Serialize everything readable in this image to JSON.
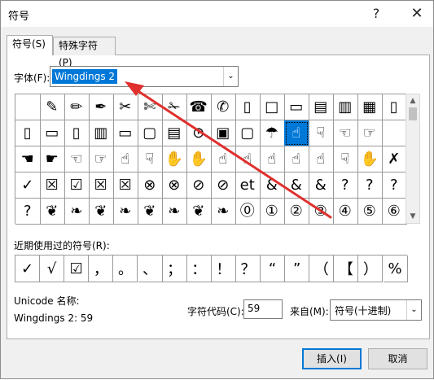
{
  "window": {
    "title": "符号",
    "help_glyph": "?",
    "close_glyph": "✕"
  },
  "tabs": [
    {
      "label": "符号(S)"
    },
    {
      "label": "特殊字符(P)"
    }
  ],
  "font": {
    "label": "字体(F):",
    "value": "Wingdings 2",
    "dropdown_glyph": "⌄"
  },
  "grid": {
    "rows": [
      [
        "",
        "✎",
        "✏",
        "✒",
        "✂",
        "✄",
        "✁",
        "☎",
        "✆",
        "▯",
        "□",
        "▭",
        "▤",
        "▥",
        "▦",
        "▯"
      ],
      [
        "▯",
        "▭",
        "▯",
        "▥",
        "▭",
        "▢",
        "▤",
        "⊙",
        "▣",
        "▢",
        "☂",
        "☝",
        "☟",
        "☜",
        "☞",
        ""
      ],
      [
        "☚",
        "☛",
        "☜",
        "☞",
        "☝",
        "☟",
        "✋",
        "✋",
        "☝",
        "☝",
        "☝",
        "☝",
        "☝",
        "☟",
        "✋",
        "✗"
      ],
      [
        "✓",
        "☒",
        "☑",
        "☒",
        "☒",
        "⊗",
        "⊗",
        "⊘",
        "⊘",
        "et",
        "&",
        "&",
        "&",
        "?",
        "?",
        "?"
      ],
      [
        "?",
        "❦",
        "❧",
        "❦",
        "❧",
        "❦",
        "❧",
        "❦",
        "❧",
        "⓪",
        "①",
        "②",
        "③",
        "④",
        "⑤",
        "⑥"
      ]
    ],
    "selected": {
      "row": 1,
      "col": 11
    },
    "scroll_up": "▲",
    "scroll_down": "▼"
  },
  "recent": {
    "label": "近期使用过的符号(R):",
    "symbols": [
      "✓",
      "√",
      "☑",
      "，",
      "。",
      "、",
      "；",
      "：",
      "！",
      "？",
      "“",
      "”",
      "（",
      "【",
      "）",
      "%"
    ]
  },
  "unicode": {
    "name_label": "Unicode 名称:",
    "name_value": "Wingdings 2: 59"
  },
  "char_code": {
    "label": "字符代码(C):",
    "value": "59"
  },
  "from": {
    "label": "来自(M):",
    "value": "符号(十进制)",
    "dropdown_glyph": "⌄"
  },
  "buttons": {
    "insert": "插入(I)",
    "cancel": "取消"
  },
  "colors": {
    "accent": "#0078d7",
    "annotation_arrow": "#e0302e"
  }
}
